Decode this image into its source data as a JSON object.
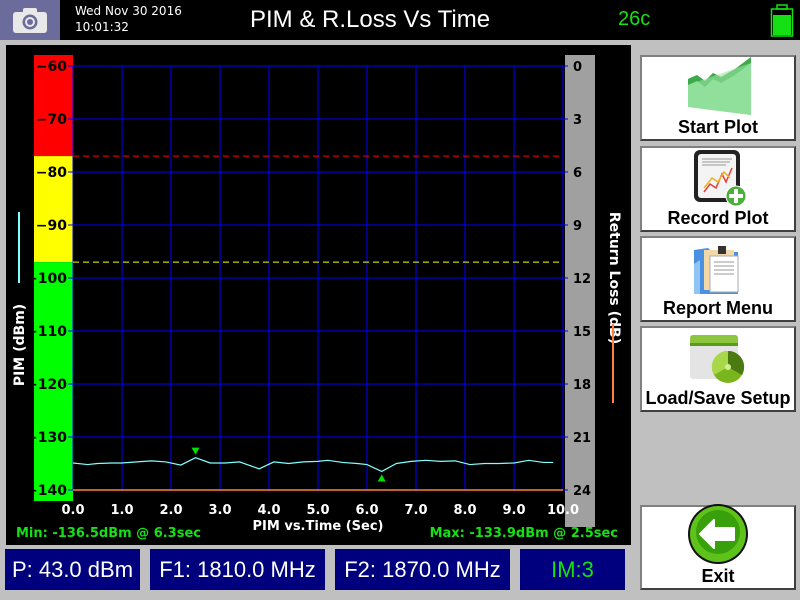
{
  "header": {
    "date": "Wed Nov 30 2016",
    "time": "10:01:32",
    "title": "PIM & R.Loss Vs Time",
    "temperature": "26c",
    "battery_icon": "battery-full-icon",
    "camera_icon": "camera-icon"
  },
  "chart": {
    "left_axis_label": "PIM (dBm)",
    "right_axis_label": "Return Loss (dB)",
    "x_axis_label": "PIM vs.Time (Sec)",
    "min_readout": "Min: -136.5dBm @ 6.3sec",
    "max_readout": "Max: -133.9dBm @ 2.5sec"
  },
  "side_buttons": [
    {
      "label": "Start Plot",
      "icon": "start-plot-icon"
    },
    {
      "label": "Record Plot",
      "icon": "record-plot-icon"
    },
    {
      "label": "Report Menu",
      "icon": "report-menu-icon"
    },
    {
      "label": "Load/Save Setup",
      "icon": "load-save-icon"
    },
    {
      "label": "Exit",
      "icon": "exit-arrow-icon"
    }
  ],
  "status_bar": {
    "power": "P: 43.0 dBm",
    "f1": "F1: 1810.0 MHz",
    "f2": "F2: 1870.0 MHz",
    "im": "IM:3"
  },
  "colors": {
    "trace": "#80ffff",
    "grid": "#0000ff",
    "zone_red": "#ff0000",
    "zone_yellow": "#ffff00",
    "zone_green": "#00ff00",
    "marker": "#00e000",
    "return_loss": "#ff8040",
    "readout": "#14e014"
  },
  "chart_data": {
    "type": "line",
    "title": "PIM & R.Loss Vs Time",
    "xlabel": "PIM vs.Time (Sec)",
    "ylabel": "PIM (dBm)",
    "y2label": "Return Loss (dB)",
    "xlim": [
      0,
      10
    ],
    "ylim": [
      -140,
      -60
    ],
    "y2lim": [
      24,
      0
    ],
    "x_ticks": [
      "0.0",
      "1.0",
      "2.0",
      "3.0",
      "4.0",
      "5.0",
      "6.0",
      "7.0",
      "8.0",
      "9.0",
      "10.0"
    ],
    "y_ticks": [
      "-60",
      "-70",
      "-80",
      "-90",
      "-100",
      "-110",
      "-120",
      "-130",
      "-140"
    ],
    "y2_ticks": [
      "0",
      "3",
      "6",
      "9",
      "12",
      "15",
      "18",
      "21",
      "24"
    ],
    "zones": [
      {
        "color": "red",
        "from": -60,
        "to": -77
      },
      {
        "color": "yellow",
        "from": -77,
        "to": -97
      },
      {
        "color": "green",
        "from": -97,
        "to": -140
      }
    ],
    "thresholds": [
      {
        "name": "red-limit",
        "value": -77,
        "color": "#ff0000",
        "style": "dashed"
      },
      {
        "name": "yellow-limit",
        "value": -97,
        "color": "#ffff00",
        "style": "dashed"
      }
    ],
    "grid": true,
    "series": [
      {
        "name": "PIM",
        "color": "#80ffff",
        "x": [
          0.0,
          0.3,
          0.5,
          0.8,
          1.0,
          1.3,
          1.6,
          1.9,
          2.2,
          2.5,
          2.8,
          3.1,
          3.4,
          3.8,
          4.1,
          4.4,
          4.7,
          5.0,
          5.2,
          5.5,
          5.8,
          6.0,
          6.3,
          6.6,
          6.9,
          7.2,
          7.5,
          7.8,
          8.1,
          8.4,
          8.7,
          9.0,
          9.3,
          9.6,
          9.8
        ],
        "y": [
          -134.9,
          -135.2,
          -135.0,
          -134.9,
          -134.9,
          -134.7,
          -134.5,
          -134.7,
          -135.3,
          -133.9,
          -134.9,
          -134.9,
          -134.7,
          -136.0,
          -134.7,
          -135.0,
          -134.7,
          -134.6,
          -134.4,
          -134.8,
          -135.0,
          -135.2,
          -136.5,
          -135.0,
          -134.6,
          -134.4,
          -134.6,
          -134.5,
          -135.2,
          -135.0,
          -135.0,
          -134.9,
          -134.4,
          -134.8,
          -134.8
        ]
      },
      {
        "name": "Return Loss",
        "color": "#ff8040",
        "x": [
          0,
          10
        ],
        "y2": [
          24,
          24
        ]
      }
    ],
    "markers": [
      {
        "name": "max-marker",
        "x": 2.5,
        "y": -133.9,
        "shape": "down-triangle"
      },
      {
        "name": "min-marker",
        "x": 6.3,
        "y": -136.5,
        "shape": "up-triangle"
      }
    ]
  }
}
